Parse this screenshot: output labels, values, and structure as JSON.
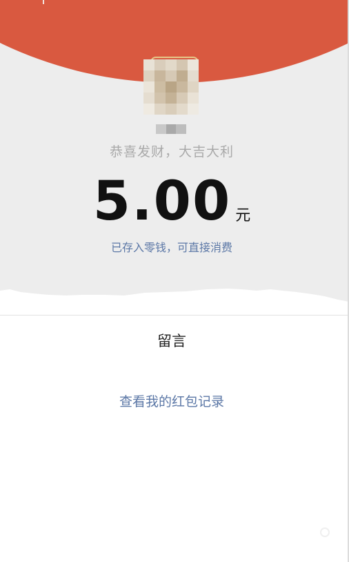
{
  "colors": {
    "header_red": "#d95940",
    "background_grey": "#ededed",
    "link_blue": "#5b77a6",
    "greeting_grey": "#a9a9a9",
    "amount_black": "#111111"
  },
  "sender": {
    "avatar_icon": "pixelated-avatar-icon",
    "greeting": "恭喜发财，大吉大利"
  },
  "amount": {
    "value": "5.00",
    "currency": "元"
  },
  "status": {
    "deposit_note": "已存入零钱，可直接消费"
  },
  "actions": {
    "message_label": "留言",
    "record_link_label": "查看我的红包记录"
  }
}
